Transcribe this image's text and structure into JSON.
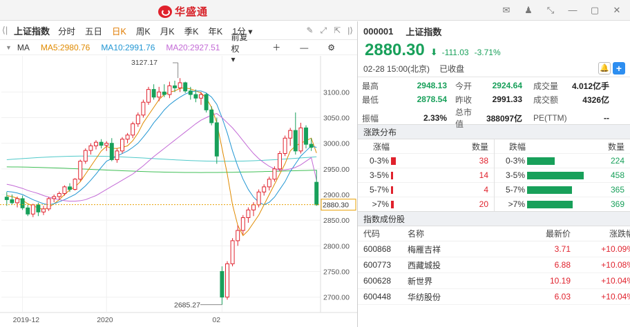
{
  "app": {
    "brand": "华盛通"
  },
  "toolbar": {
    "title": "上证指数",
    "periods": [
      "分时",
      "五日",
      "日K",
      "周K",
      "月K",
      "季K",
      "年K",
      "1分"
    ],
    "active_period": "日K"
  },
  "ma_legend": {
    "label": "MA",
    "ma5": "MA5:2980.76",
    "ma10": "MA10:2991.76",
    "ma20": "MA20:2927.51",
    "adjust": "前复权"
  },
  "colors": {
    "up": "#e0212c",
    "down": "#18a05a",
    "ma5": "#e08a00",
    "ma10": "#2196d3",
    "ma20": "#c36ad6"
  },
  "stock": {
    "code": "000001",
    "name": "上证指数",
    "price": "2880.30",
    "change": "-111.03",
    "change_pct": "-3.71%",
    "datetime": "02-28 15:00(北京)",
    "status": "已收盘"
  },
  "quotes": [
    {
      "l1": "最高",
      "v1": "2948.13",
      "l2": "今开",
      "v2": "2924.64",
      "l3": "成交量",
      "v3": "4.012亿手"
    },
    {
      "l1": "最低",
      "v1": "2878.54",
      "l2": "昨收",
      "v2": "2991.33",
      "l3": "成交额",
      "v3": "4326亿"
    },
    {
      "l1": "振幅",
      "v1": "2.33%",
      "l2": "总市值",
      "v2": "388097亿",
      "l3": "PE(TTM)",
      "v3": "--"
    }
  ],
  "distribution": {
    "title": "涨跌分布",
    "left_header": {
      "label": "涨幅",
      "count": "数量"
    },
    "right_header": {
      "label": "跌幅",
      "count": "数量"
    },
    "rows": [
      {
        "up_label": "0-3%",
        "up_count": 38,
        "down_label": "0-3%",
        "down_count": 224
      },
      {
        "up_label": "3-5%",
        "up_count": 14,
        "down_label": "3-5%",
        "down_count": 458
      },
      {
        "up_label": "5-7%",
        "up_count": 4,
        "down_label": "5-7%",
        "down_count": 365
      },
      {
        "up_label": ">7%",
        "up_count": 20,
        "down_label": ">7%",
        "down_count": 369
      }
    ]
  },
  "components": {
    "title": "指数成份股",
    "headers": {
      "code": "代码",
      "name": "名称",
      "price": "最新价",
      "chg": "涨跌幅"
    },
    "rows": [
      {
        "code": "600868",
        "name": "梅雁吉祥",
        "price": "3.71",
        "chg": "+10.09%"
      },
      {
        "code": "600773",
        "name": "西藏城投",
        "price": "6.88",
        "chg": "+10.08%"
      },
      {
        "code": "600628",
        "name": "新世界",
        "price": "10.19",
        "chg": "+10.04%"
      },
      {
        "code": "600448",
        "name": "华纺股份",
        "price": "6.03",
        "chg": "+10.04%"
      }
    ]
  },
  "chart_data": {
    "type": "candlestick",
    "y_ticks": [
      3100,
      3050,
      3000,
      2950,
      2900,
      2850,
      2800,
      2750,
      2700
    ],
    "ylim": [
      2670,
      3165
    ],
    "x_labels": [
      "2019-12",
      "2020",
      "02"
    ],
    "annotations": {
      "high": "3127.17",
      "low": "2685.27",
      "current": "2880.30"
    },
    "candles": [
      [
        2895,
        2905,
        2878,
        2890
      ],
      [
        2890,
        2900,
        2880,
        2884
      ],
      [
        2884,
        2896,
        2875,
        2892
      ],
      [
        2892,
        2898,
        2870,
        2874
      ],
      [
        2874,
        2880,
        2858,
        2862
      ],
      [
        2862,
        2882,
        2856,
        2880
      ],
      [
        2880,
        2884,
        2858,
        2866
      ],
      [
        2866,
        2878,
        2860,
        2872
      ],
      [
        2872,
        2895,
        2868,
        2892
      ],
      [
        2892,
        2900,
        2885,
        2896
      ],
      [
        2896,
        2906,
        2890,
        2902
      ],
      [
        2902,
        2918,
        2898,
        2915
      ],
      [
        2915,
        2922,
        2905,
        2910
      ],
      [
        2910,
        2932,
        2908,
        2930
      ],
      [
        2930,
        2968,
        2926,
        2965
      ],
      [
        2965,
        2990,
        2960,
        2986
      ],
      [
        2986,
        3000,
        2978,
        2995
      ],
      [
        2995,
        3006,
        2988,
        3002
      ],
      [
        3002,
        3008,
        2990,
        2996
      ],
      [
        2996,
        3004,
        2985,
        3000
      ],
      [
        3000,
        3010,
        2965,
        2968
      ],
      [
        2968,
        2990,
        2962,
        2985
      ],
      [
        2985,
        3012,
        2980,
        3008
      ],
      [
        3008,
        3020,
        3000,
        3016
      ],
      [
        3016,
        3042,
        3010,
        3038
      ],
      [
        3038,
        3060,
        3032,
        3055
      ],
      [
        3055,
        3085,
        3050,
        3080
      ],
      [
        3080,
        3110,
        3075,
        3105
      ],
      [
        3105,
        3115,
        3085,
        3090
      ],
      [
        3090,
        3110,
        3082,
        3100
      ],
      [
        3100,
        3115,
        3090,
        3095
      ],
      [
        3095,
        3120,
        3088,
        3112
      ],
      [
        3112,
        3122,
        3100,
        3108
      ],
      [
        3108,
        3127,
        3100,
        3118
      ],
      [
        3118,
        3120,
        3098,
        3102
      ],
      [
        3102,
        3110,
        3085,
        3095
      ],
      [
        3095,
        3105,
        3080,
        3088
      ],
      [
        3088,
        3100,
        3075,
        3095
      ],
      [
        3095,
        3098,
        3060,
        3065
      ],
      [
        3065,
        3072,
        3035,
        3040
      ],
      [
        3040,
        3050,
        2960,
        2975
      ],
      [
        2750,
        2760,
        2685,
        2700
      ],
      [
        2700,
        2770,
        2695,
        2765
      ],
      [
        2765,
        2815,
        2760,
        2810
      ],
      [
        2810,
        2840,
        2800,
        2830
      ],
      [
        2830,
        2860,
        2822,
        2855
      ],
      [
        2855,
        2875,
        2845,
        2870
      ],
      [
        2870,
        2885,
        2858,
        2880
      ],
      [
        2880,
        2910,
        2875,
        2905
      ],
      [
        2905,
        2920,
        2898,
        2915
      ],
      [
        2915,
        2935,
        2908,
        2930
      ],
      [
        2930,
        2955,
        2925,
        2950
      ],
      [
        2950,
        2985,
        2945,
        2980
      ],
      [
        2980,
        3015,
        2975,
        3010
      ],
      [
        3010,
        3030,
        2995,
        3025
      ],
      [
        3025,
        3060,
        2978,
        2985
      ],
      [
        2985,
        3040,
        2980,
        3030
      ],
      [
        3030,
        3035,
        2990,
        2998
      ],
      [
        2998,
        3010,
        2985,
        2992
      ],
      [
        2924,
        2948,
        2878,
        2880
      ]
    ],
    "ma_series": [
      {
        "name": "MA5",
        "values": [
          2898,
          2896,
          2893,
          2889,
          2882,
          2878,
          2874,
          2871,
          2875,
          2882,
          2890,
          2900,
          2909,
          2915,
          2925,
          2940,
          2955,
          2970,
          2985,
          2994,
          2990,
          2990,
          2992,
          2995,
          3005,
          3020,
          3040,
          3055,
          3070,
          3085,
          3095,
          3100,
          3102,
          3107,
          3108,
          3106,
          3102,
          3098,
          3088,
          3070,
          3040,
          2990,
          2940,
          2880,
          2840,
          2820,
          2830,
          2845,
          2860,
          2880,
          2900,
          2920,
          2940,
          2960,
          2985,
          2995,
          3000,
          3005,
          3010,
          2981
        ]
      },
      {
        "name": "MA10",
        "values": [
          2906,
          2905,
          2903,
          2900,
          2895,
          2890,
          2886,
          2882,
          2880,
          2882,
          2886,
          2890,
          2895,
          2900,
          2908,
          2917,
          2928,
          2940,
          2953,
          2965,
          2970,
          2975,
          2980,
          2985,
          2992,
          3000,
          3012,
          3025,
          3040,
          3052,
          3065,
          3075,
          3083,
          3090,
          3096,
          3100,
          3102,
          3102,
          3098,
          3090,
          3076,
          3050,
          3020,
          2985,
          2955,
          2930,
          2910,
          2895,
          2885,
          2880,
          2885,
          2895,
          2910,
          2925,
          2945,
          2960,
          2975,
          2985,
          2995,
          2992
        ]
      },
      {
        "name": "MA20",
        "values": [
          2920,
          2918,
          2915,
          2912,
          2908,
          2905,
          2902,
          2898,
          2895,
          2892,
          2890,
          2888,
          2887,
          2887,
          2888,
          2890,
          2894,
          2898,
          2904,
          2910,
          2916,
          2922,
          2928,
          2934,
          2940,
          2948,
          2956,
          2965,
          2974,
          2982,
          2990,
          2998,
          3006,
          3014,
          3022,
          3030,
          3038,
          3045,
          3050,
          3055,
          3058,
          3050,
          3040,
          3030,
          3018,
          3005,
          2992,
          2980,
          2970,
          2962,
          2955,
          2950,
          2948,
          2948,
          2950,
          2953,
          2958,
          2965,
          2972,
          2928
        ]
      }
    ],
    "long_ma": [
      {
        "name": "MA60",
        "values_start": 2968,
        "values_end": 2972
      },
      {
        "name": "MA120",
        "values_start": 2950,
        "values_end": 2945
      }
    ]
  }
}
